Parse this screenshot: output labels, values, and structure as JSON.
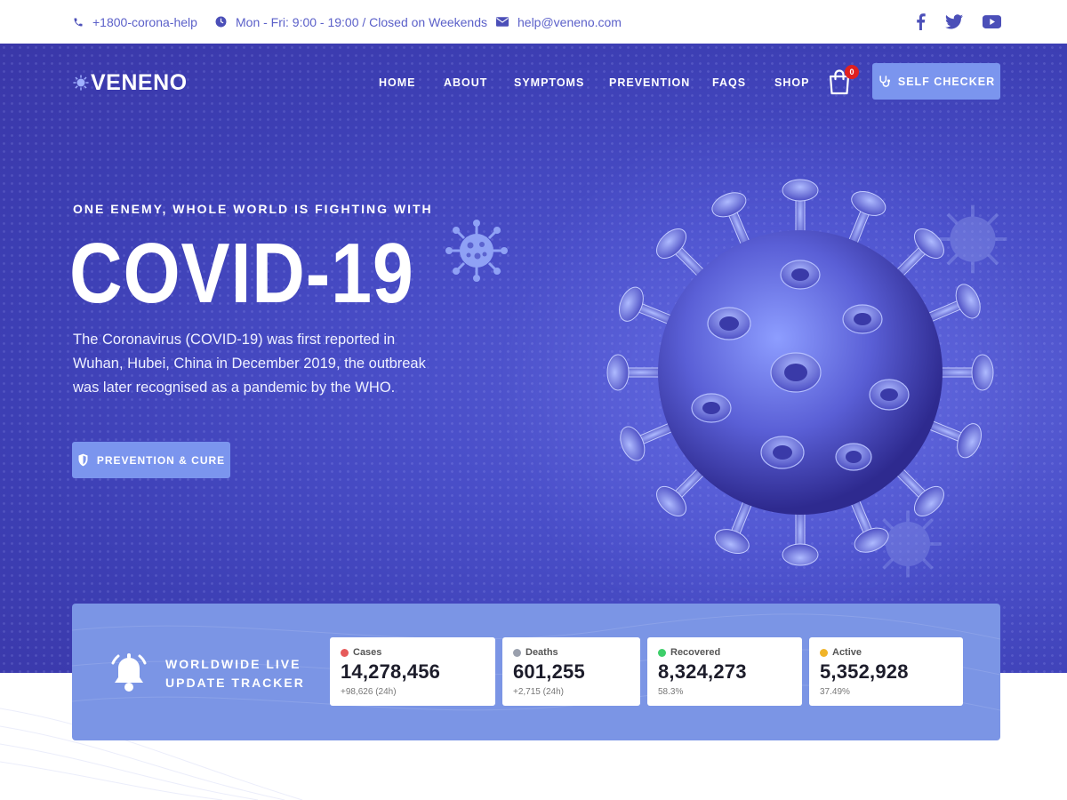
{
  "topbar": {
    "phone": "+1800-corona-help",
    "hours": "Mon - Fri: 9:00 - 19:00 / Closed on Weekends",
    "email": "help@veneno.com",
    "social": [
      "facebook-icon",
      "twitter-icon",
      "youtube-icon"
    ]
  },
  "brand": {
    "name": "VENENO"
  },
  "nav": {
    "items": [
      {
        "label": "HOME"
      },
      {
        "label": "ABOUT"
      },
      {
        "label": "SYMPTOMS"
      },
      {
        "label": "PREVENTION"
      },
      {
        "label": "FAQS"
      },
      {
        "label": "SHOP"
      }
    ],
    "cart_count": "0",
    "cta_label": "SELF CHECKER"
  },
  "hero": {
    "tagline": "ONE ENEMY, WHOLE WORLD IS FIGHTING WITH",
    "headline": "COVID-19",
    "description": "The Coronavirus (COVID-19) was first reported in Wuhan, Hubei, China in December 2019, the outbreak was later recognised as a pandemic by the WHO.",
    "button_label": "PREVENTION & CURE"
  },
  "tracker": {
    "title_line1": "WORLDWIDE LIVE",
    "title_line2": "UPDATE TRACKER",
    "stats": [
      {
        "label": "Cases",
        "value": "14,278,456",
        "sub": "+98,626 (24h)",
        "color": "#e65a5a"
      },
      {
        "label": "Deaths",
        "value": "601,255",
        "sub": "+2,715 (24h)",
        "color": "#9aa0ad"
      },
      {
        "label": "Recovered",
        "value": "8,324,273",
        "sub": "58.3%",
        "color": "#3ecf6a"
      },
      {
        "label": "Active",
        "value": "5,352,928",
        "sub": "37.49%",
        "color": "#f0b429"
      }
    ]
  },
  "colors": {
    "accent": "#7b95ee",
    "hero_bg": "#3d3fb4",
    "topbar_text": "#5b60c9",
    "badge": "#e02020"
  }
}
